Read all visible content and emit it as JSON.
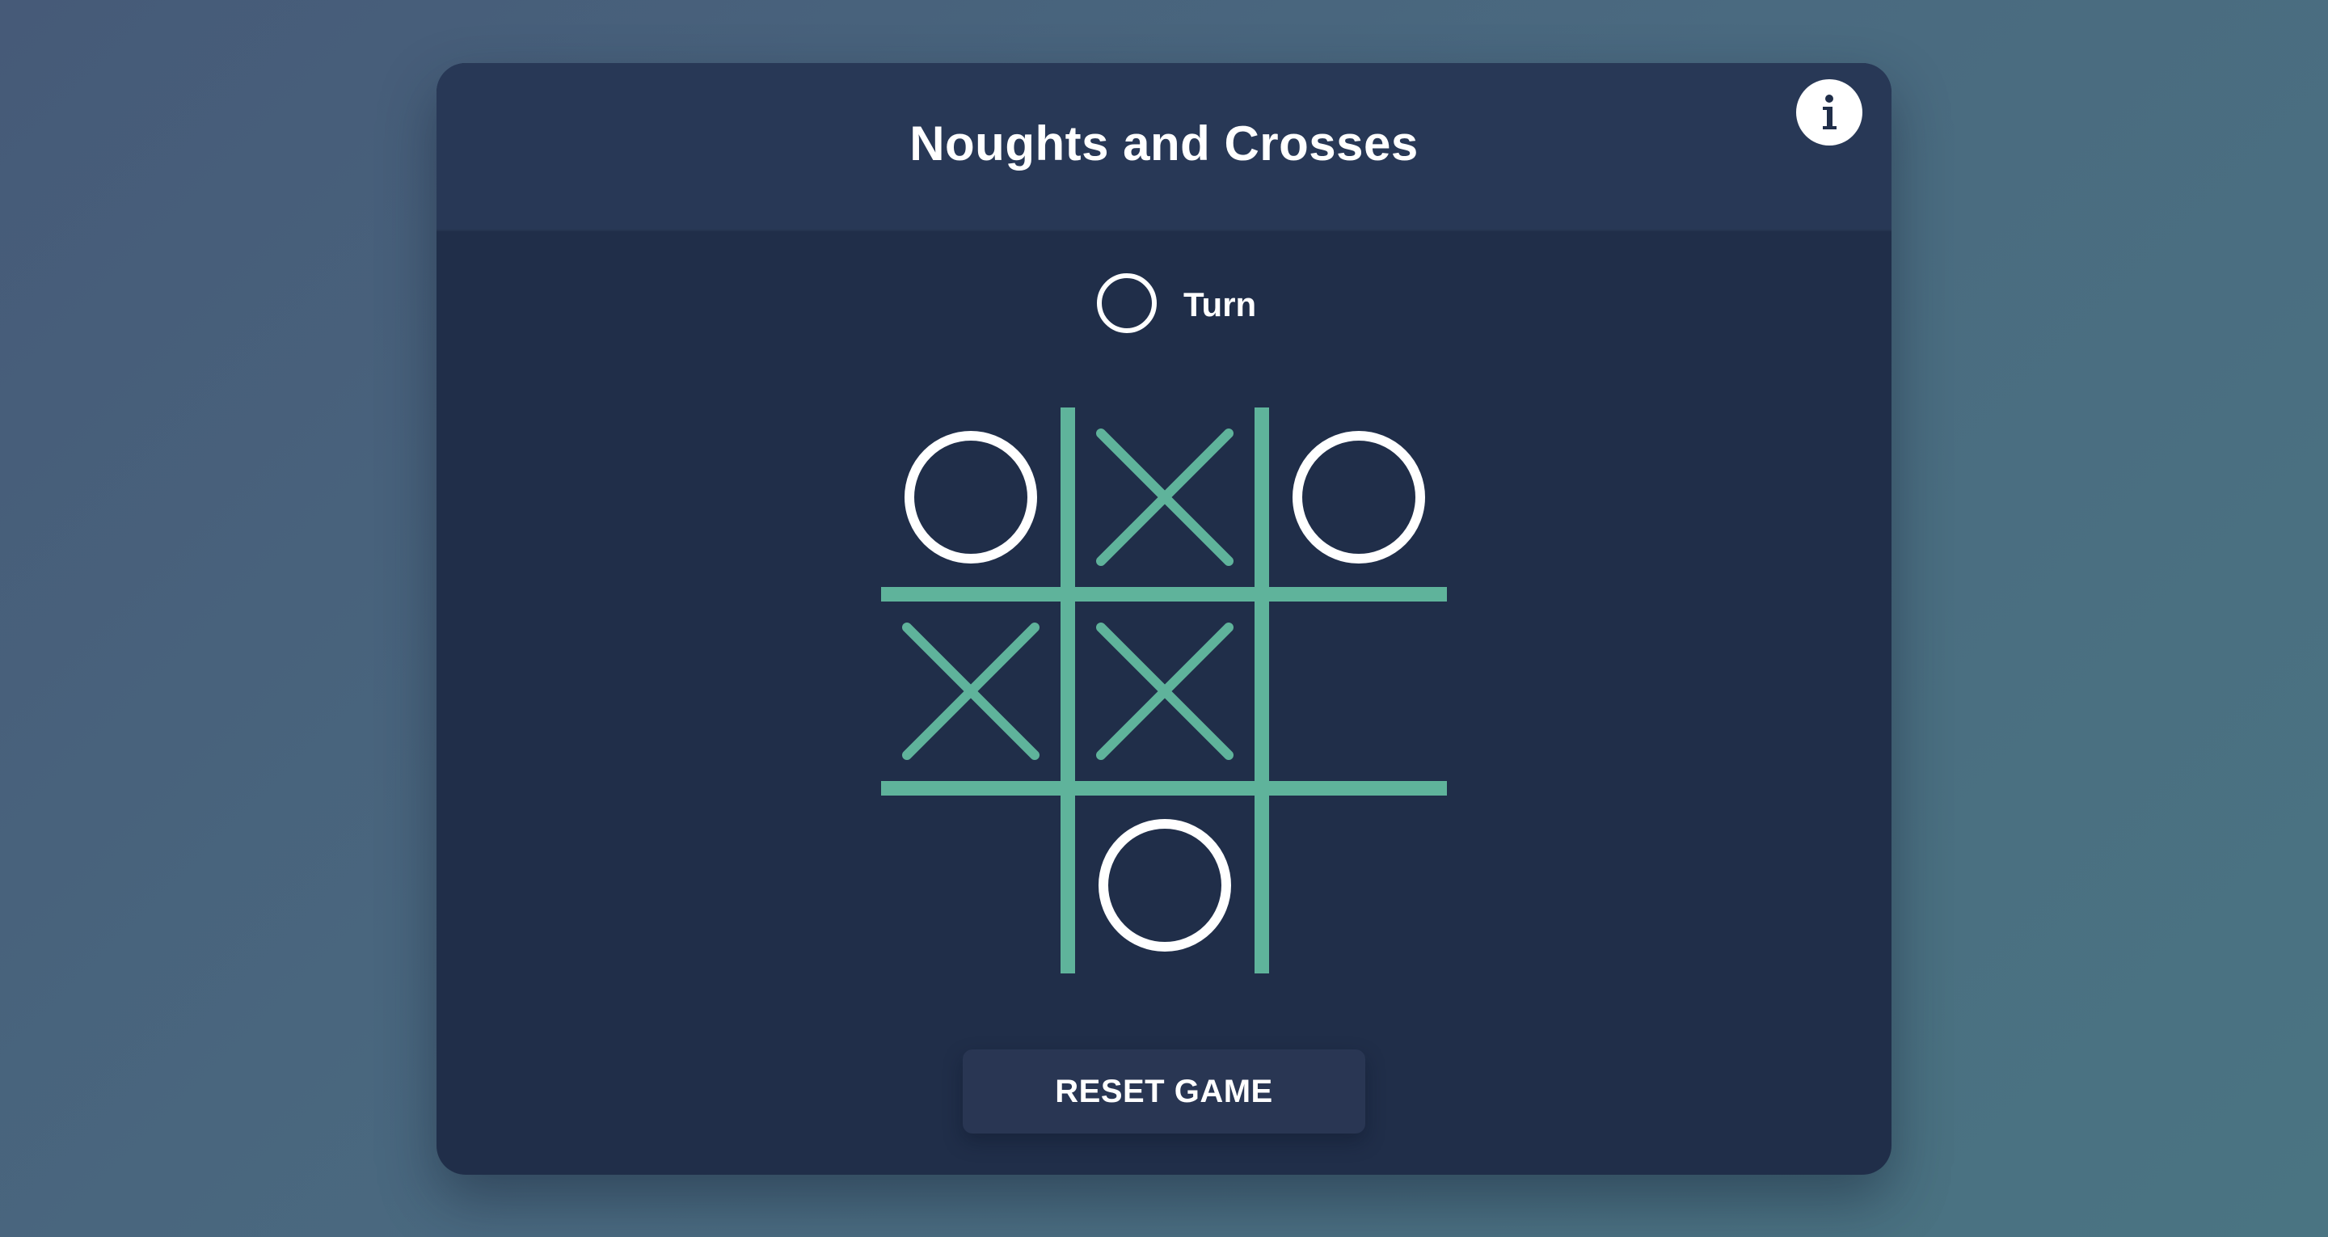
{
  "title": "Noughts and Crosses",
  "info_button": {
    "icon": "info-icon",
    "glyph": "i"
  },
  "turn": {
    "label": "Turn",
    "current_player": "O"
  },
  "board": {
    "cells": [
      "O",
      "X",
      "O",
      "X",
      "X",
      "",
      "",
      "O",
      ""
    ]
  },
  "reset_button": {
    "label": "RESET GAME"
  },
  "colors": {
    "card_background": "#202e49",
    "header_background": "#283856",
    "grid_and_x": "#5fb39b",
    "o_mark": "#ffffff",
    "text": "#ffffff"
  }
}
